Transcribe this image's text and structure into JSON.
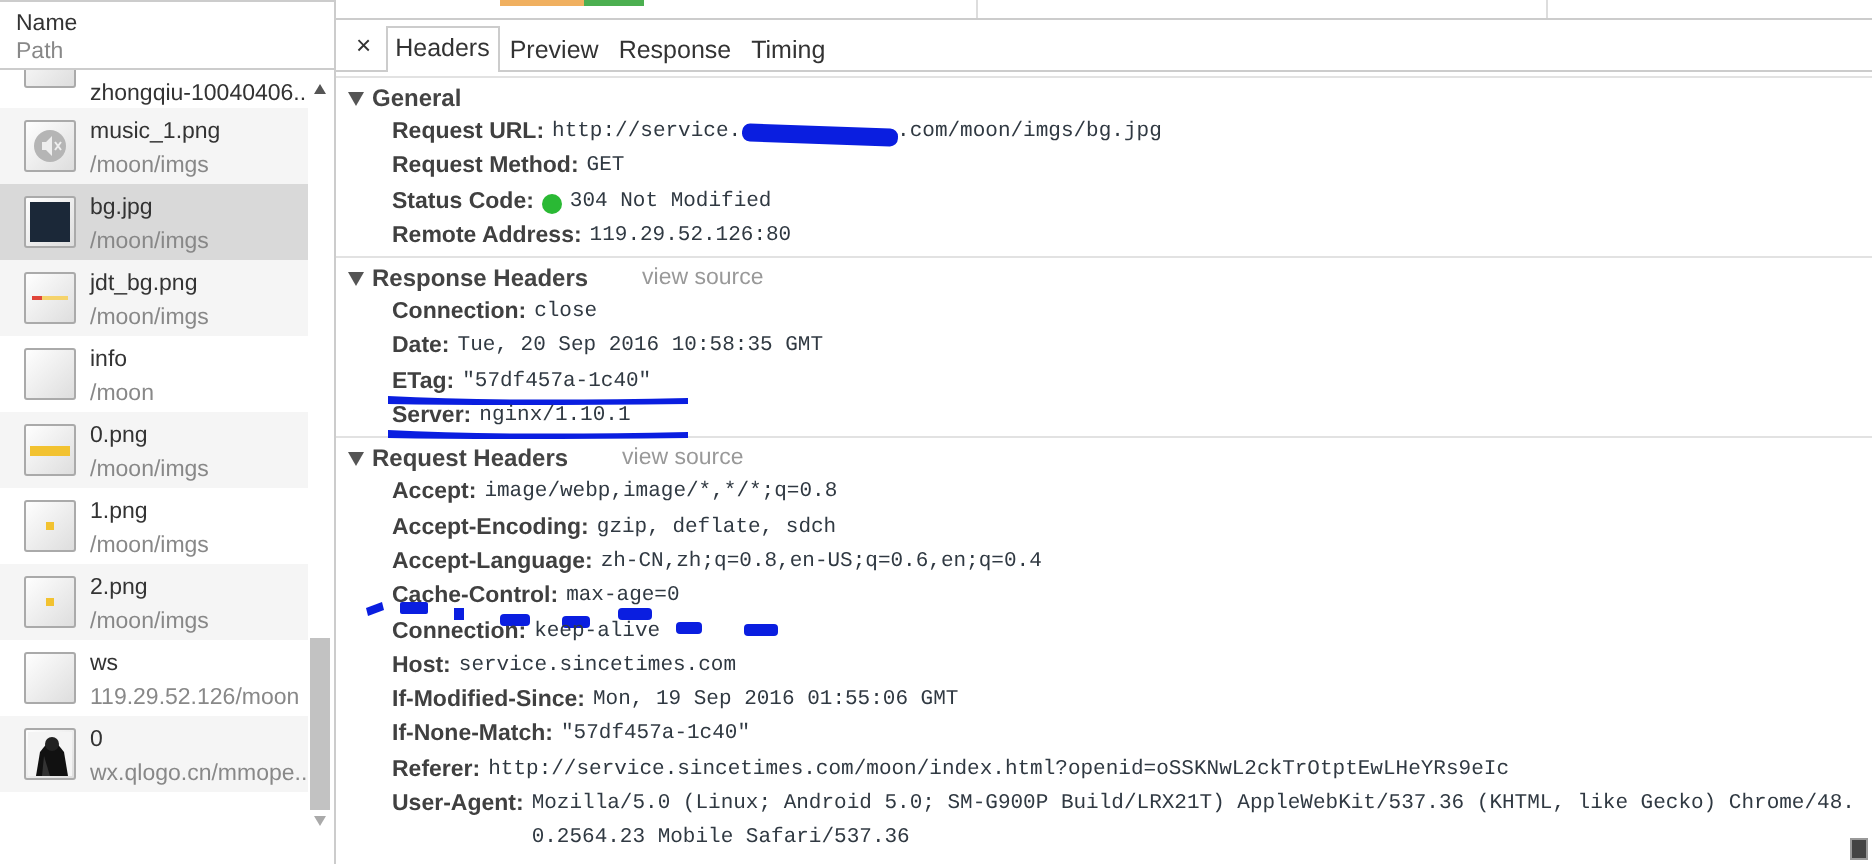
{
  "request_list": {
    "columns": [
      "Name",
      "Path"
    ],
    "items": [
      {
        "name": "zhongqiu-10040406...",
        "kind": "blank",
        "selected": false
      },
      {
        "name": "music_1.png",
        "path": "/moon/imgs",
        "kind": "mute",
        "selected": false
      },
      {
        "name": "bg.jpg",
        "path": "/moon/imgs",
        "kind": "dark",
        "selected": true
      },
      {
        "name": "jdt_bg.png",
        "path": "/moon/imgs",
        "kind": "bar",
        "selected": false
      },
      {
        "name": "info",
        "path": "/moon",
        "kind": "blank",
        "selected": false
      },
      {
        "name": "0.png",
        "path": "/moon/imgs",
        "kind": "label",
        "selected": false
      },
      {
        "name": "1.png",
        "path": "/moon/imgs",
        "kind": "dot",
        "selected": false
      },
      {
        "name": "2.png",
        "path": "/moon/imgs",
        "kind": "dot",
        "selected": false
      },
      {
        "name": "ws",
        "path": "119.29.52.126/moon",
        "kind": "blank",
        "selected": false
      },
      {
        "name": "0",
        "path": "wx.qlogo.cn/mmope...",
        "kind": "picture",
        "selected": false
      }
    ]
  },
  "detail": {
    "close": "×",
    "tabs": [
      {
        "label": "Headers",
        "selected": true
      },
      {
        "label": "Preview",
        "selected": false
      },
      {
        "label": "Response",
        "selected": false
      },
      {
        "label": "Timing",
        "selected": false
      }
    ],
    "sections": [
      {
        "title": "General",
        "expanded": true,
        "rows": [
          {
            "key": "Request URL:",
            "value": "http://service.",
            "redacted": true,
            "value_after": ".com/moon/imgs/bg.jpg"
          },
          {
            "key": "Request Method:",
            "value": "GET"
          },
          {
            "key": "Status Code:",
            "color": "#2ab934",
            "value": "304 Not Modified"
          },
          {
            "key": "Remote Address:",
            "value": "119.29.52.126:80"
          }
        ]
      },
      {
        "title": "Response Headers",
        "link": "view source",
        "expanded": true,
        "rows": [
          {
            "key": "Connection:",
            "value": "close"
          },
          {
            "key": "Date:",
            "value": "Tue, 20 Sep 2016 10:58:35 GMT"
          },
          {
            "key": "ETag:",
            "value": "\"57df457a-1c40\"",
            "underlined": true
          },
          {
            "key": "Server:",
            "value": "nginx/1.10.1",
            "underlined": true
          }
        ]
      },
      {
        "title": "Request Headers",
        "link": "view source",
        "expanded": true,
        "rows": [
          {
            "key": "Accept:",
            "value": "image/webp,image/*,*/*;q=0.8"
          },
          {
            "key": "Accept-Encoding:",
            "value": "gzip, deflate, sdch"
          },
          {
            "key": "Accept-Language:",
            "value": "zh-CN,zh;q=0.8,en-US;q=0.6,en;q=0.4"
          },
          {
            "key": "Cache-Control:",
            "value": "max-age=0",
            "dash_marked": true
          },
          {
            "key": "Connection:",
            "value": "keep-alive"
          },
          {
            "key": "Host:",
            "value": "service.sincetimes.com"
          },
          {
            "key": "If-Modified-Since:",
            "value": "Mon, 19 Sep 2016 01:55:06 GMT"
          },
          {
            "key": "If-None-Match:",
            "value": "\"57df457a-1c40\""
          },
          {
            "key": "Referer:",
            "value": "http://service.sincetimes.com/moon/index.html?openid=oSSKNwL2ckTrOtptEwLHeYRs9eIc"
          },
          {
            "key": "User-Agent:",
            "value": "Mozilla/5.0 (Linux; Android 5.0; SM-G900P Build/LRX21T) AppleWebKit/537.36 (KHTML, like Gecko) Chrome/48.0.2564.23 Mobile Safari/537.36"
          }
        ]
      }
    ]
  }
}
